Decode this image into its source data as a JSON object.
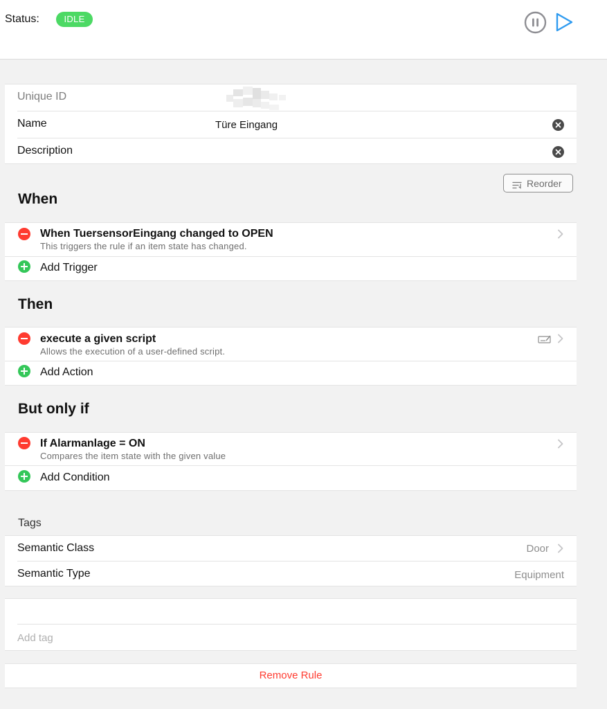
{
  "header": {
    "status_label": "Status:",
    "status_value": "IDLE",
    "status_color": "#4cd964",
    "pause_icon": "pause-circle-icon",
    "play_icon": "play-icon",
    "accent_color": "#2f9bf0"
  },
  "details": {
    "unique_id_label": "Unique ID",
    "name_label": "Name",
    "name_value": "Türe Eingang",
    "description_label": "Description",
    "description_value": ""
  },
  "reorder": {
    "label": "Reorder",
    "icon": "reorder-icon"
  },
  "when": {
    "title": "When",
    "items": [
      {
        "title": "When TuersensorEingang changed to OPEN",
        "subtitle": "This triggers the rule if an item state has changed."
      }
    ],
    "add_label": "Add Trigger"
  },
  "then": {
    "title": "Then",
    "items": [
      {
        "title": "execute a given script",
        "subtitle": "Allows the execution of a user-defined script."
      }
    ],
    "add_label": "Add Action"
  },
  "but_only_if": {
    "title": "But only if",
    "items": [
      {
        "title": "If Alarmanlage = ON",
        "subtitle": "Compares the item state with the given value"
      }
    ],
    "add_label": "Add Condition"
  },
  "tags": {
    "header": "Tags",
    "semantic_class_label": "Semantic Class",
    "semantic_class_value": "Door",
    "semantic_type_label": "Semantic Type",
    "semantic_type_value": "Equipment",
    "add_tag_placeholder": "Add tag"
  },
  "remove_rule_label": "Remove Rule",
  "remove_color": "#ff3b30"
}
